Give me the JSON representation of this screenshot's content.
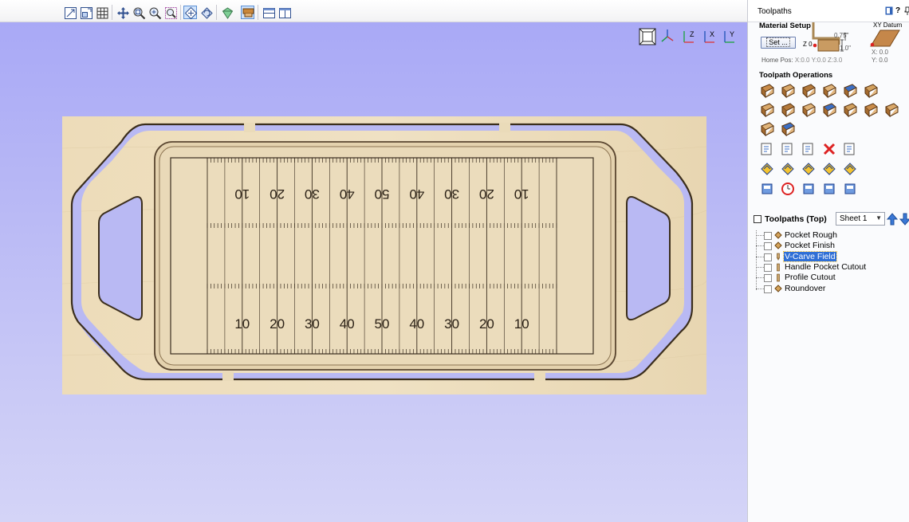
{
  "toolbar": {
    "buttons": [
      "zoom-extents",
      "zoom-fit",
      "grid",
      "pan",
      "zoom-box",
      "zoom-in",
      "zoom-out",
      "select-mode",
      "rotate",
      "render-shaded",
      "material",
      "tile-horizontal",
      "tile-vertical"
    ]
  },
  "view": {
    "axis_labels": [
      "Z",
      "X",
      "Y",
      "Z",
      "X",
      "Y"
    ]
  },
  "board": {
    "top_numbers": [
      "10",
      "20",
      "30",
      "40",
      "50",
      "40",
      "30",
      "20",
      "10"
    ],
    "bottom_numbers": [
      "10",
      "20",
      "30",
      "40",
      "50",
      "40",
      "30",
      "20",
      "10"
    ]
  },
  "panel": {
    "title": "Toolpaths",
    "help": "?",
    "material_setup": {
      "label": "Material Setup",
      "set_button": "Set ...",
      "z0": "Z 0",
      "thickness_top": "0.75\"",
      "thickness_bottom": "1.0\"",
      "home_pos_label": "Home Pos:",
      "home_pos_value": "X:0.0 Y:0.0 Z:3.0",
      "xy_datum_label": "XY Datum",
      "x_value": "X: 0.0",
      "y_value": "Y: 0.0"
    },
    "operations_label": "Toolpath Operations",
    "operations": [
      "profile-toolpath-icon",
      "pocket-toolpath-icon",
      "drilling-toolpath-icon",
      "quick-engrave-icon",
      "texture-toolpath-icon",
      "inlay-toolpath-icon",
      "vcarve-toolpath-icon",
      "prism-carve-icon",
      "fluting-toolpath-icon",
      "3d-roughing-icon",
      "3d-finishing-icon",
      "moulding-toolpath-icon",
      "profile-3d-icon",
      "texture-3d-icon",
      "sphere-toolpath-icon",
      "toolpath-list-icon",
      "edit-toolpath-icon",
      "copy-toolpath-icon",
      "delete-toolpath-icon",
      "tool-database-icon",
      "preview-selected-icon",
      "preview-all-icon",
      "preview-visible-icon",
      "reset-preview-icon",
      "material-preview-icon",
      "toolpath-summary-icon",
      "time-estimate-icon",
      "merge-toolpaths-icon",
      "template-icon",
      "save-toolpath-icon"
    ],
    "toolpaths_header": "Toolpaths (Top)",
    "sheet_select": "Sheet 1",
    "toolpaths": [
      {
        "name": "Pocket Rough",
        "icon": "pocket-icon",
        "selected": false
      },
      {
        "name": "Pocket Finish",
        "icon": "pocket-icon",
        "selected": false
      },
      {
        "name": "V-Carve Field",
        "icon": "vbit-icon",
        "selected": true
      },
      {
        "name": "Handle Pocket Cutout",
        "icon": "endmill-icon",
        "selected": false
      },
      {
        "name": "Profile Cutout",
        "icon": "endmill-icon",
        "selected": false
      },
      {
        "name": "Roundover",
        "icon": "pocket-icon",
        "selected": false
      }
    ]
  },
  "colors": {
    "wood": "#eadbb9",
    "wood_dark": "#cdb88f",
    "view_bg_top": "#a9a9f6",
    "view_bg_bottom": "#d4d4f7",
    "selection": "#2f6fd6"
  }
}
